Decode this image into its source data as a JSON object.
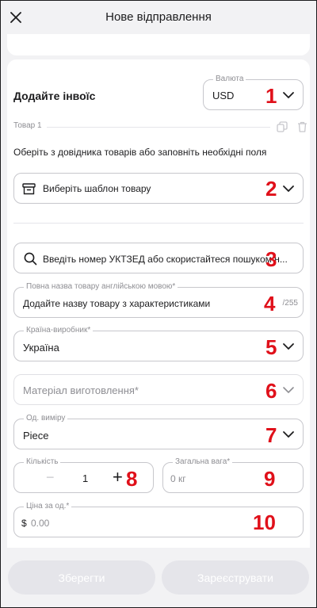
{
  "header": {
    "title": "Нове відправлення"
  },
  "invoice": {
    "section_title": "Додайте інвоїс",
    "currency": {
      "label": "Валюта",
      "value": "USD"
    }
  },
  "item": {
    "label": "Товар 1",
    "hint": "Оберіть з довідника товарів або заповніть необхідні поля",
    "template_select": {
      "placeholder": "Виберіть шаблон товару"
    },
    "hs_search": {
      "placeholder": "Введіть номер УКТЗЕД або скористайтеся пошуком н..."
    },
    "english_name": {
      "label": "Повна назва товару англійською мовою*",
      "placeholder": "Додайте назву товару з характеристиками",
      "counter": "/255"
    },
    "country": {
      "label": "Країна-виробник*",
      "value": "Україна"
    },
    "material": {
      "placeholder": "Матеріал виготовлення*"
    },
    "unit": {
      "label": "Од. виміру",
      "value": "Piece"
    },
    "quantity": {
      "label": "Кількість",
      "value": "1",
      "minus": "−",
      "plus": "+"
    },
    "total_weight": {
      "label": "Загальна вага*",
      "placeholder": "0 кг"
    },
    "unit_price": {
      "label": "Ціна за од.*",
      "currency_symbol": "$",
      "placeholder": "0.00"
    }
  },
  "annotations": [
    "1",
    "2",
    "3",
    "4",
    "5",
    "6",
    "7",
    "8",
    "9",
    "10"
  ],
  "footer": {
    "save_label": "Зберегти",
    "register_label": "Зареєструвати"
  },
  "colors": {
    "annotation": "#e0101a",
    "disabled_button": "#e5e5ea",
    "border": "#c7c7cc"
  }
}
